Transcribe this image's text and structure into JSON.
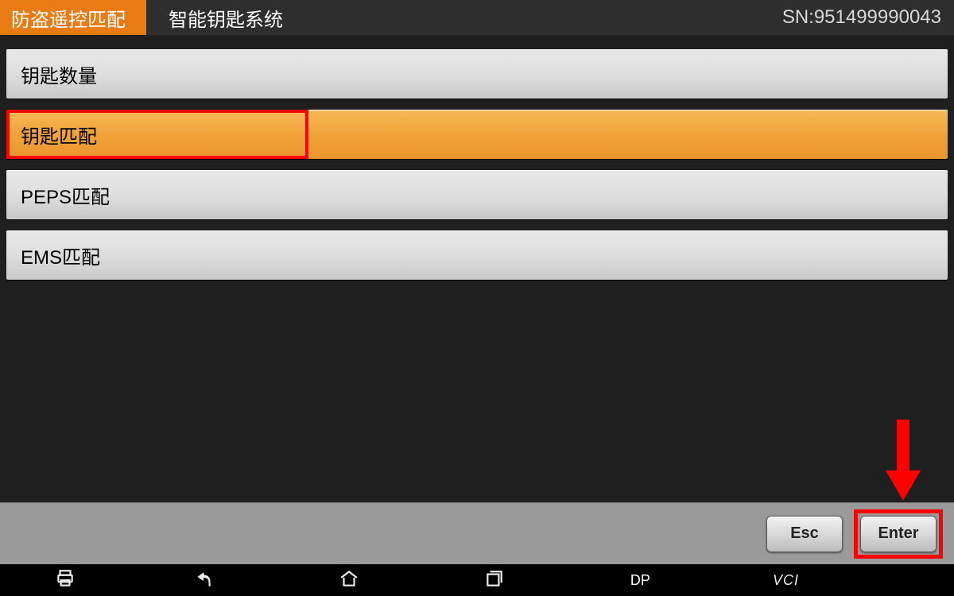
{
  "header": {
    "mode": "防盗遥控匹配",
    "subtitle": "智能钥匙系统",
    "sn_label": "SN:951499990043"
  },
  "menu": {
    "items": [
      {
        "label": "钥匙数量",
        "selected": false,
        "highlight": false
      },
      {
        "label": "钥匙匹配",
        "selected": true,
        "highlight": true
      },
      {
        "label": "PEPS匹配",
        "selected": false,
        "highlight": false
      },
      {
        "label": "EMS匹配",
        "selected": false,
        "highlight": false
      }
    ]
  },
  "actions": {
    "esc": "Esc",
    "enter": "Enter",
    "enter_highlight": true
  },
  "nav": {
    "dp": "DP",
    "vci": "VCI"
  },
  "colors": {
    "accent": "#e87c13",
    "highlight": "#ff0000",
    "selected_row": "#f1a33a"
  }
}
